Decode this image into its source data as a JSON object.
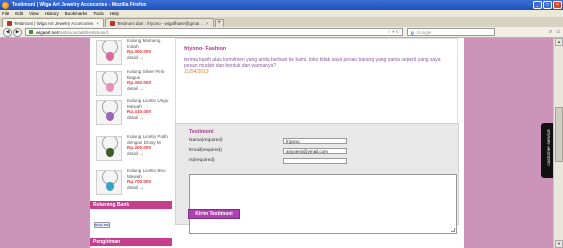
{
  "window": {
    "title": "Testimoni | Wiga Art Jewelry Accecories - Mozilla Firefox",
    "controls": [
      "_",
      "□",
      "×"
    ]
  },
  "menubar": [
    "File",
    "Edit",
    "View",
    "History",
    "Bookmarks",
    "Tools",
    "Help"
  ],
  "tabs": [
    {
      "label": "Testimoni | Wiga Art Jewelry Accecories",
      "active": true
    },
    {
      "label": "Tesimoni dari : friyono - wigafhase@gmai...",
      "active": false
    }
  ],
  "navbar": {
    "url_host": "wigaart.net",
    "url_path": "/testimoni/add/testimoni/1",
    "url_tools": "☆ ▾ C",
    "search_placeholder": "Google"
  },
  "products": [
    {
      "name": "Kalung Mamang Indah",
      "price": "Rp.300.000",
      "detail": "detail →",
      "stone_color": "#d86b9a"
    },
    {
      "name": "Kalung Silver Pink Bagus",
      "price": "Rp.350.000",
      "detail": "detail →",
      "stone_color": "#e790b8"
    },
    {
      "name": "Kalung Liontin Ungu Mewah",
      "price": "Rp.410.000",
      "detail": "detail →",
      "stone_color": "#9a67b5"
    },
    {
      "name": "Kalung Liontin Putih dengan Drusy M",
      "price": "Rp.300.000",
      "detail": "detail →",
      "stone_color": "#3d5a2a"
    },
    {
      "name": "Kalung Liontin Biru Mewah",
      "price": "Rp.700.000",
      "detail": "detail →",
      "stone_color": "#3aa0c8"
    }
  ],
  "sidebar": {
    "bank_header": "Rekening Bank",
    "bank_logo": "BANK BRI",
    "shipping_header": "Pengiriman"
  },
  "testimonial": {
    "name": "friyono- Fashion",
    "message": "terima kasih atas komitmen yang anda berikan ke kami. toko tidak saya pesan barang yang sama seperti yang saya pesan mudah dan bentuk dan warnanya?",
    "date": "11/04/2013"
  },
  "form": {
    "title": "Testimoni",
    "name_label": "Nama(required)",
    "name_value": "friyono",
    "email_label": "Email(required)",
    "email_value": "anyoemi@ymail.com",
    "web_label": "Isi(required)",
    "web_value": "",
    "submit_label": "Kirim Testimoni"
  },
  "widget": {
    "label": "customer service"
  },
  "colors": {
    "page_bg": "#cd94b9",
    "accent": "#c43f8e",
    "button": "#b141b2",
    "price": "#e23b3b"
  }
}
